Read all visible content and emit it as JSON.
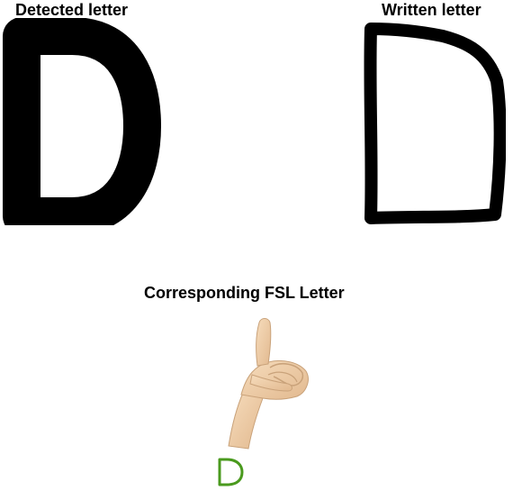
{
  "labels": {
    "detected": "Detected letter",
    "written": "Written letter",
    "fsl": "Corresponding FSL Letter"
  },
  "letters": {
    "detected": "D",
    "written": "D",
    "fsl": "D"
  },
  "colors": {
    "text": "#000000",
    "fsl_letter": "#4a9a1e",
    "skin": "#f0d2b0"
  },
  "icons": {
    "hand": "fsl-hand-sign-d-icon"
  }
}
